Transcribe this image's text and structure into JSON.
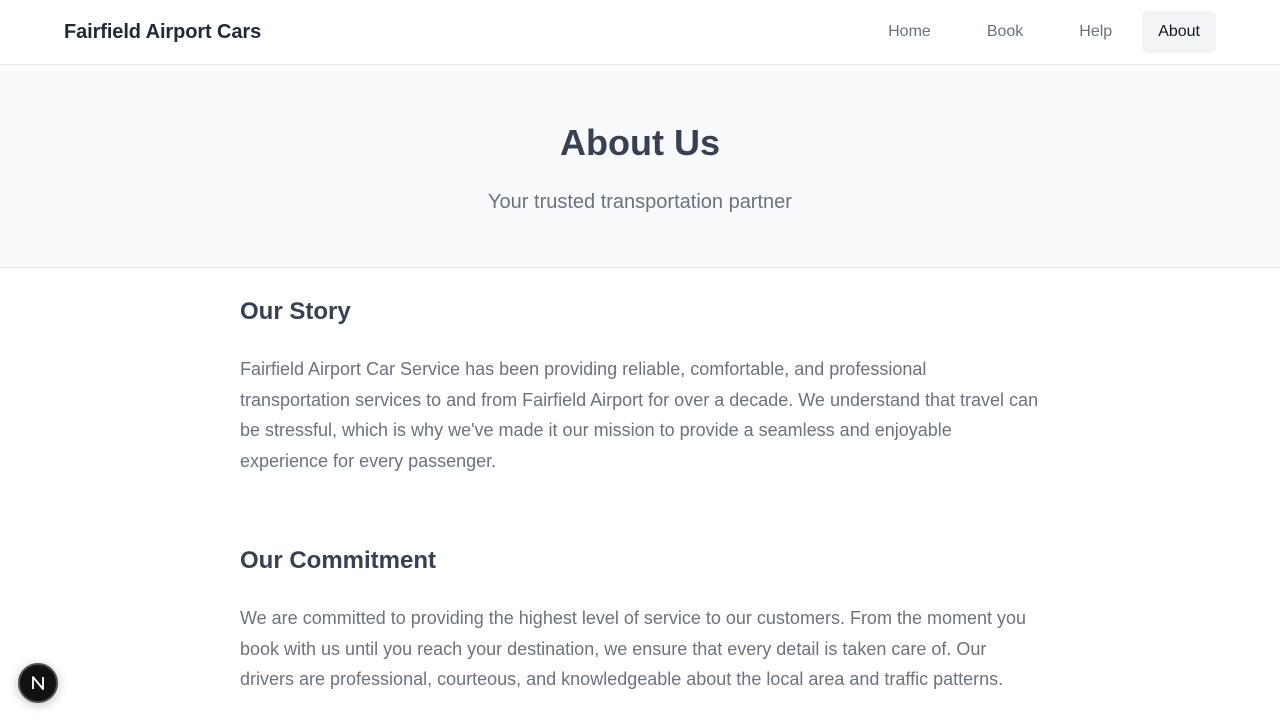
{
  "header": {
    "brand": "Fairfield Airport Cars",
    "nav": [
      {
        "label": "Home"
      },
      {
        "label": "Book"
      },
      {
        "label": "Help"
      },
      {
        "label": "About"
      }
    ]
  },
  "hero": {
    "title": "About Us",
    "subtitle": "Your trusted transportation partner"
  },
  "sections": [
    {
      "title": "Our Story",
      "body": "Fairfield Airport Car Service has been providing reliable, comfortable, and professional transportation services to and from Fairfield Airport for over a decade. We understand that travel can be stressful, which is why we've made it our mission to provide a seamless and enjoyable experience for every passenger."
    },
    {
      "title": "Our Commitment",
      "body": "We are committed to providing the highest level of service to our customers. From the moment you book with us until you reach your destination, we ensure that every detail is taken care of. Our drivers are professional, courteous, and knowledgeable about the local area and traffic patterns."
    }
  ],
  "dev_badge": {
    "icon": "nextjs-logo-icon",
    "letter": "N"
  }
}
